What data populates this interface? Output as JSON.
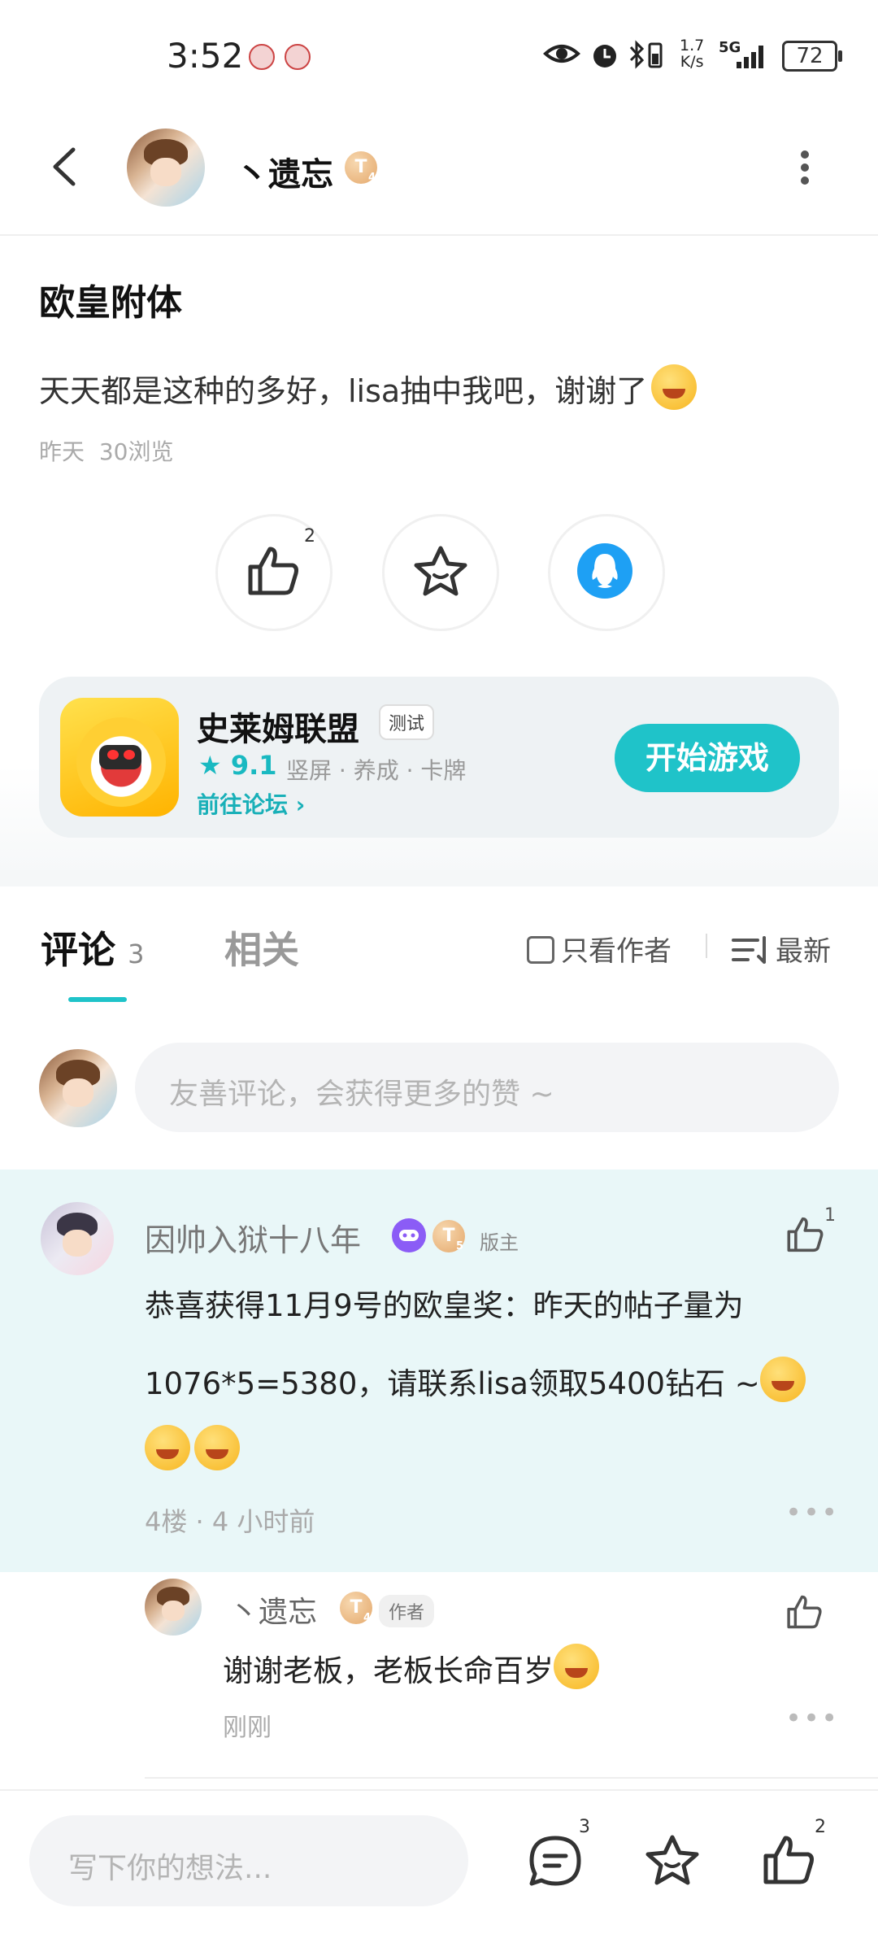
{
  "status_bar": {
    "time": "3:52",
    "speed_top": "1.7",
    "speed_bottom": "K/s",
    "network": "5G",
    "battery": "72"
  },
  "header": {
    "username": "丶遗忘",
    "level_badge": "T",
    "level_sub": "4"
  },
  "post": {
    "title": "欧皇附体",
    "body": "天天都是这种的多好，lisa抽中我吧，谢谢了",
    "meta_date": "昨天",
    "meta_views": "30浏览",
    "like_count": "2"
  },
  "game_card": {
    "name": "史莱姆联盟",
    "tag": "测试",
    "rating": "9.1",
    "tags": "竖屏 · 养成 · 卡牌",
    "forum_link": "前往论坛",
    "play_button": "开始游戏"
  },
  "tabs": {
    "comments_label": "评论",
    "comments_count": "3",
    "related_label": "相关",
    "author_only": "只看作者",
    "sort_label": "最新"
  },
  "comment_input": {
    "placeholder": "友善评论，会获得更多的赞 ~"
  },
  "comments": [
    {
      "author": "因帅入狱十八年",
      "level_badge": "T",
      "level_sub": "5",
      "role": "版主",
      "likes": "1",
      "text_line1": "恭喜获得11月9号的欧皇奖：昨天的帖子量为",
      "text_line2": "1076*5=5380，请联系lisa领取5400钻石 ~",
      "floor": "4楼",
      "time": "4 小时前",
      "reply": {
        "author": "丶遗忘",
        "level_badge": "T",
        "level_sub": "4",
        "role": "作者",
        "text": "谢谢老板，老板长命百岁",
        "time": "刚刚"
      }
    }
  ],
  "bottom_bar": {
    "placeholder": "写下你的想法...",
    "comment_count": "3",
    "like_count": "2"
  },
  "colors": {
    "accent": "#1fc3c9",
    "comment_bg": "#e9f7f8",
    "qq_blue": "#1ea0f4"
  }
}
